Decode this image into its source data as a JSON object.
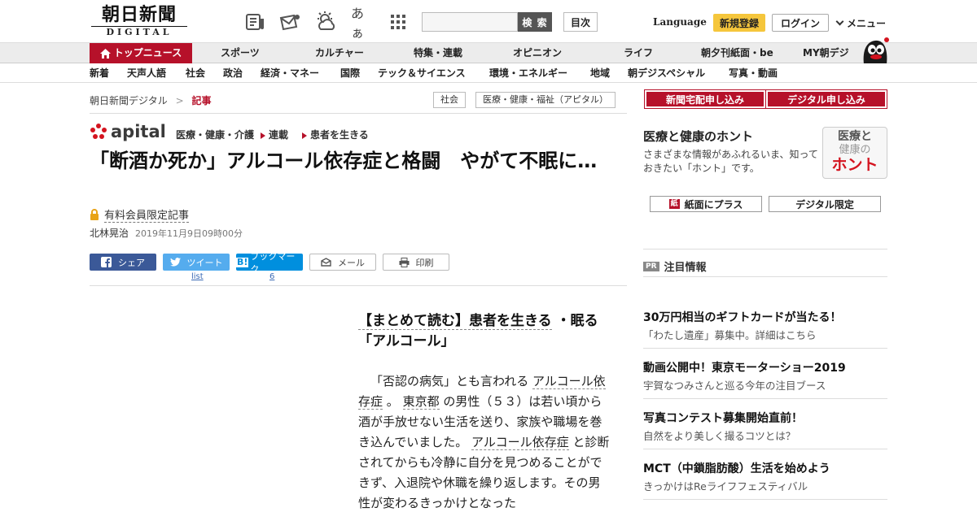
{
  "header": {
    "logo_main": "朝日新聞",
    "logo_sub": "DIGITAL",
    "search_button": "検 索",
    "contents_button": "目次",
    "font_size_label": "あぁ",
    "language": "Language",
    "signup": "新規登録",
    "login": "ログイン",
    "menu": "メニュー"
  },
  "nav_primary": [
    "トップニュース",
    "スポーツ",
    "カルチャー",
    "特集・連載",
    "オピニオン",
    "ライフ",
    "朝夕刊紙面・be",
    "MY朝デジ"
  ],
  "nav_secondary": [
    "新着",
    "天声人語",
    "社会",
    "政治",
    "経済・マネー",
    "国際",
    "テック＆サイエンス",
    "環境・エネルギー",
    "地域",
    "朝デジスペシャル",
    "写真・動画"
  ],
  "breadcrumb": {
    "home": "朝日新聞デジタル",
    "separator": ">",
    "current": "記事",
    "tags": [
      "社会",
      "医療・健康・福祉（アピタル）"
    ]
  },
  "article": {
    "brand": "apital",
    "category": "医療・健康・介護",
    "series_label": "連載",
    "series_name": "患者を生きる",
    "headline": "「断酒か死か」アルコール依存症と格闘　やがて不眠に…",
    "paid_label": "有料会員限定記事",
    "author": "北林晃治",
    "date": "2019年11月9日09時00分",
    "share": {
      "facebook": "シェア",
      "twitter": "ツイート",
      "twitter_count": "list",
      "hatena": "ブックマーク",
      "hatena_count": "6",
      "mail": "メール",
      "print": "印刷"
    },
    "lede_part1": "【まとめて読む】患者を生きる",
    "lede_part2": "・眠る「アルコール」",
    "body": [
      {
        "text": "「否認の病気」とも言われる",
        "link": false
      },
      {
        "text": "アルコール依存症",
        "link": true
      },
      {
        "text": "。",
        "link": false
      },
      {
        "text": "東京都",
        "link": true
      },
      {
        "text": "の男性（５３）は若い頃から酒が手放せない生活を送り、家族や職場を巻き込んでいました。",
        "link": false
      },
      {
        "text": "アルコール依存症",
        "link": true
      },
      {
        "text": "と診断されてからも冷静に自分を見つめることができず、入退院や休職を繰り返します。その男性が変わるきっかけとなった",
        "link": false
      }
    ]
  },
  "sidebar": {
    "subscribe_paper": "新聞宅配申し込み",
    "subscribe_digital": "デジタル申し込み",
    "honto_title": "医療と健康のホント",
    "honto_desc": "さまざまな情報があふれるいま、知っておきたい「ホント」です。",
    "honto_badge_line1": "医療と",
    "honto_badge_line2": "健康の",
    "honto_badge_line3": "ホント",
    "paper_plus": "紙面にプラス",
    "digital_only": "デジタル限定",
    "pr_badge": "PR",
    "pr_heading": "注目情報",
    "pr_items": [
      {
        "title": "30万円相当のギフトカードが当たる！",
        "sub": "「わたし遺産」募集中。詳細はこちら"
      },
      {
        "title": "動画公開中！東京モーターショー2019",
        "sub": "宇賀なつみさんと巡る今年の注目ブース"
      },
      {
        "title": "写真コンテスト募集開始直前！",
        "sub": "自然をより美しく撮るコツとは？"
      },
      {
        "title": "MCT（中鎖脂肪酸）生活を始めよう",
        "sub": "きっかけはReライフフェスティバル"
      }
    ]
  },
  "colors": {
    "brand_red": "#b6112a",
    "signup_yellow": "#f5c63c",
    "facebook_blue": "#3b5998",
    "twitter_blue": "#55acee",
    "hatena_blue": "#008fde"
  }
}
